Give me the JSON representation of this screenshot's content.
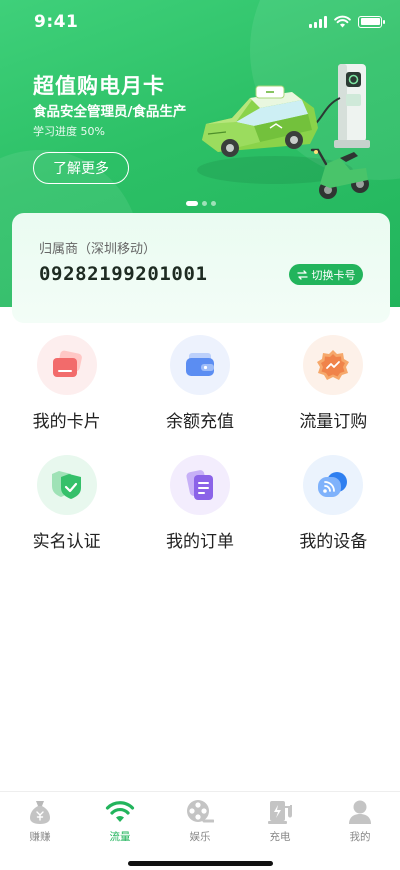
{
  "status_bar": {
    "time": "9:41"
  },
  "banner": {
    "title": "超值购电月卡",
    "subtitle": "食品安全管理员/食品生产",
    "progress_text": "学习进度 50%",
    "progress_value": 0.5,
    "button_label": "了解更多",
    "page_count": 3,
    "active_page": 0
  },
  "card": {
    "label": "归属商（深圳移动）",
    "number": "09282199201001",
    "switch_label": "切换卡号"
  },
  "services": [
    {
      "label": "我的卡片",
      "icon": "card-icon"
    },
    {
      "label": "余额充值",
      "icon": "wallet-icon"
    },
    {
      "label": "流量订购",
      "icon": "traffic-icon"
    },
    {
      "label": "实名认证",
      "icon": "shield-check-icon"
    },
    {
      "label": "我的订单",
      "icon": "order-icon"
    },
    {
      "label": "我的设备",
      "icon": "device-icon"
    }
  ],
  "tabbar": {
    "active_index": 1,
    "items": [
      {
        "label": "赚赚",
        "icon": "money-bag-icon"
      },
      {
        "label": "流量",
        "icon": "wifi-icon"
      },
      {
        "label": "娱乐",
        "icon": "film-reel-icon"
      },
      {
        "label": "充电",
        "icon": "charger-icon"
      },
      {
        "label": "我的",
        "icon": "person-icon"
      }
    ]
  },
  "colors": {
    "brand_green": "#22b45c",
    "banner_gradient_start": "#3fd07a",
    "text_primary": "#222222"
  }
}
